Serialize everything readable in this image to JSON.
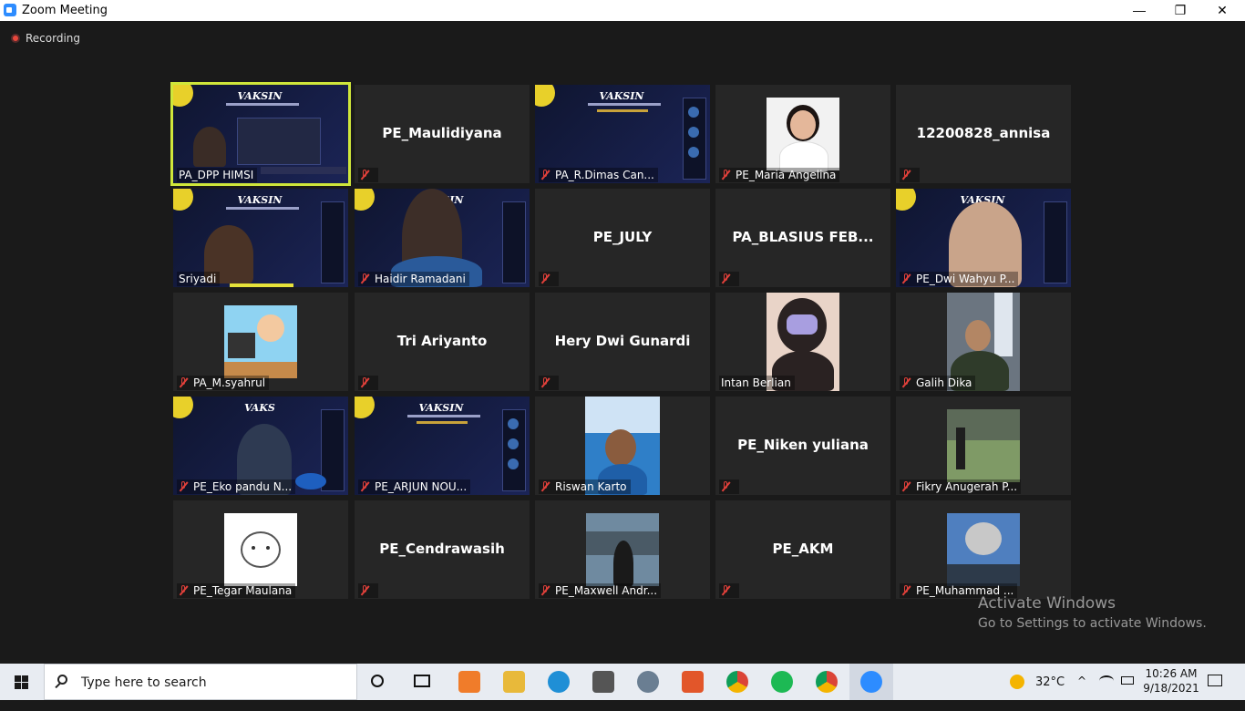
{
  "window": {
    "title": "Zoom Meeting",
    "minimize": "—",
    "restore": "❐",
    "close": "✕"
  },
  "recording": {
    "label": "Recording"
  },
  "tiles": {
    "r1c1": {
      "name": "PA_DPP HIMSI",
      "slide_title": "VAKSIN"
    },
    "r1c2": {
      "name": "PE_Maulidiyana"
    },
    "r1c3": {
      "name": "PA_R.Dimas Can...",
      "slide_title": "VAKSIN"
    },
    "r1c4": {
      "name": "PE_Maria Angelina"
    },
    "r1c5": {
      "name": "12200828_annisa"
    },
    "r2c1": {
      "name": "Sriyadi",
      "slide_title": "VAKSIN"
    },
    "r2c2": {
      "name": "Haidir Ramadani",
      "slide_title": "VAKSIN"
    },
    "r2c3": {
      "name": "PE_JULY"
    },
    "r2c4": {
      "name": "PA_BLASIUS FEB..."
    },
    "r2c5": {
      "name": "PE_Dwi Wahyu P...",
      "slide_title": "VAKSIN"
    },
    "r3c1": {
      "name": "PA_M.syahrul"
    },
    "r3c2": {
      "name": "Tri Ariyanto"
    },
    "r3c3": {
      "name": "Hery Dwi Gunardi"
    },
    "r3c4": {
      "name": "Intan Berlian"
    },
    "r3c5": {
      "name": "Galih Dika"
    },
    "r4c1": {
      "name": "PE_Eko pandu N...",
      "slide_title": "VAKS"
    },
    "r4c2": {
      "name": "PE_ARJUN NOU...",
      "slide_title": "VAKSIN"
    },
    "r4c3": {
      "name": "Riswan Karto"
    },
    "r4c4": {
      "name": "PE_Niken yuliana"
    },
    "r4c5": {
      "name": "Fikry Anugerah P..."
    },
    "r5c1": {
      "name": "PE_Tegar Maulana"
    },
    "r5c2": {
      "name": "PE_Cendrawasih"
    },
    "r5c3": {
      "name": "PE_Maxwell Andr..."
    },
    "r5c4": {
      "name": "PE_AKM"
    },
    "r5c5": {
      "name": "PE_Muhammad ..."
    }
  },
  "watermark": {
    "line1": "Activate Windows",
    "line2": "Go to Settings to activate Windows."
  },
  "taskbar": {
    "search_placeholder": "Type here to search",
    "weather": "32°C",
    "time": "10:26 AM",
    "date": "9/18/2021"
  },
  "colors": {
    "active_speaker": "#cfe63a",
    "muted_mic": "#e0403a",
    "tile_bg": "#262626",
    "stage_bg": "#1a1a1a"
  }
}
